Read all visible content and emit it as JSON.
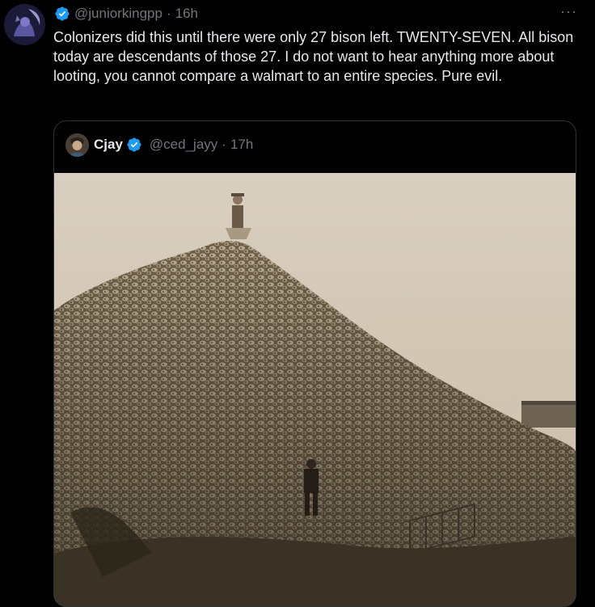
{
  "tweet": {
    "handle": "@juniorkingpp",
    "separator": "·",
    "time": "16h",
    "more_icon": "more-icon",
    "text": "Colonizers did this until there were only 27 bison left. TWENTY-SEVEN. All bison today are descendants of those 27. I do not want to hear anything more about looting, you cannot compare a walmart to an entire species. Pure evil."
  },
  "quote": {
    "name": "Cjay",
    "handle": "@ced_jayy",
    "separator": "·",
    "time": "17h"
  },
  "colors": {
    "background": "#000000",
    "text": "#e7e9ea",
    "muted": "#71767b",
    "verified": "#1d9bf0",
    "border": "#2f3336"
  }
}
